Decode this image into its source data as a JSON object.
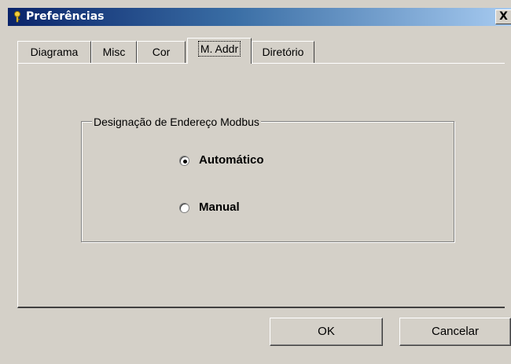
{
  "window": {
    "title": "Preferências",
    "close_label": "X",
    "icon": "key-icon"
  },
  "tabs": [
    {
      "label": "Diagrama",
      "active": false
    },
    {
      "label": "Misc",
      "active": false
    },
    {
      "label": "Cor",
      "active": false
    },
    {
      "label": "M. Addr",
      "active": true
    },
    {
      "label": "Diretório",
      "active": false
    }
  ],
  "group": {
    "title": "Designação de Endereço Modbus",
    "options": [
      {
        "label": "Automático",
        "selected": true
      },
      {
        "label": "Manual",
        "selected": false
      }
    ]
  },
  "buttons": {
    "ok": "OK",
    "cancel": "Cancelar"
  }
}
